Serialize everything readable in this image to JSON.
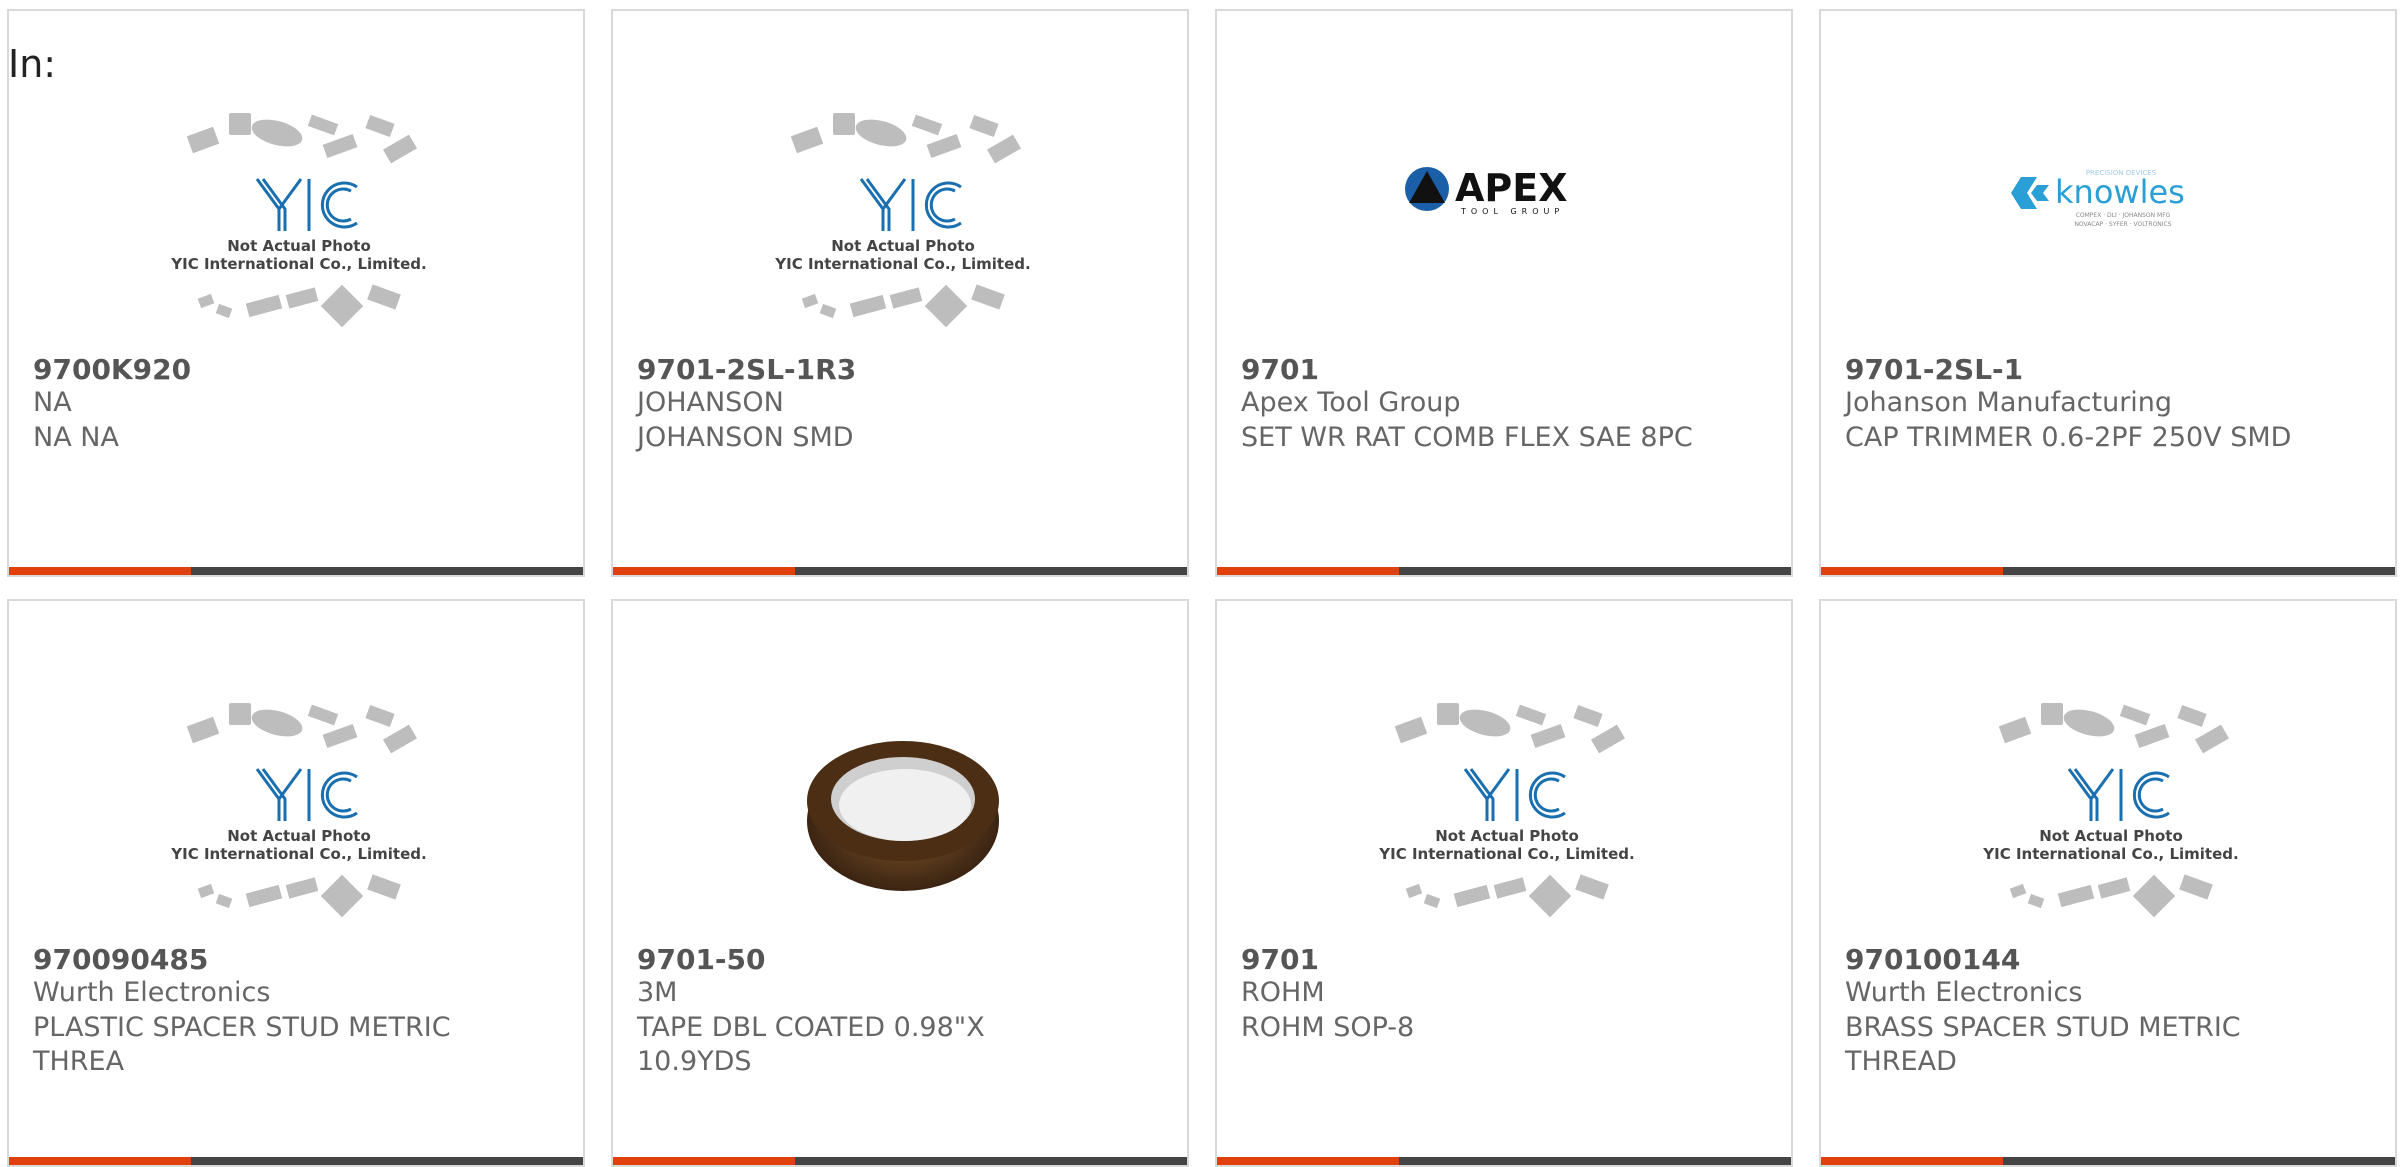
{
  "header": {
    "label": "In:"
  },
  "products": [
    {
      "part_number": "9700K920",
      "manufacturer": "NA",
      "description": "NA NA",
      "image": "yic-not-actual-photo"
    },
    {
      "part_number": "9701-2SL-1R3",
      "manufacturer": "JOHANSON",
      "description": "JOHANSON SMD",
      "image": "yic-not-actual-photo"
    },
    {
      "part_number": "9701",
      "manufacturer": "Apex Tool Group",
      "description": "SET WR RAT COMB FLEX SAE 8PC",
      "image": "apex-tool-group-logo"
    },
    {
      "part_number": "9701-2SL-1",
      "manufacturer": "Johanson Manufacturing",
      "description": "CAP TRIMMER 0.6-2PF 250V SMD",
      "image": "knowles-logo"
    },
    {
      "part_number": "970090485",
      "manufacturer": "Wurth Electronics",
      "description": "PLASTIC SPACER STUD METRIC THREA",
      "image": "yic-not-actual-photo"
    },
    {
      "part_number": "9701-50",
      "manufacturer": "3M",
      "description": "TAPE DBL COATED 0.98\"X 10.9YDS",
      "image": "tape-roll-photo"
    },
    {
      "part_number": "9701",
      "manufacturer": "ROHM",
      "description": "ROHM SOP-8",
      "image": "yic-not-actual-photo"
    },
    {
      "part_number": "970100144",
      "manufacturer": "Wurth Electronics",
      "description": "BRASS SPACER STUD METRIC THREAD",
      "image": "yic-not-actual-photo"
    }
  ],
  "placeholder_image": {
    "line1": "Not Actual Photo",
    "line2": "YIC International Co., Limited.",
    "brand": "YIC"
  },
  "logos": {
    "apex_word": "APEX",
    "apex_sub": "TOOL GROUP",
    "knowles_word": "knowles",
    "knowles_tag": "PRECISION DEVICES",
    "knowles_sub1": "COMPEX · DLI · JOHANSON MFG",
    "knowles_sub2": "NOVACAP · SYFER · VOLTRONICS"
  },
  "colors": {
    "accent": "#e0400c",
    "bar": "#444444",
    "border": "#d9d9d9",
    "yic_blue": "#1a6fb0",
    "knowles_blue": "#2a9fd6"
  }
}
